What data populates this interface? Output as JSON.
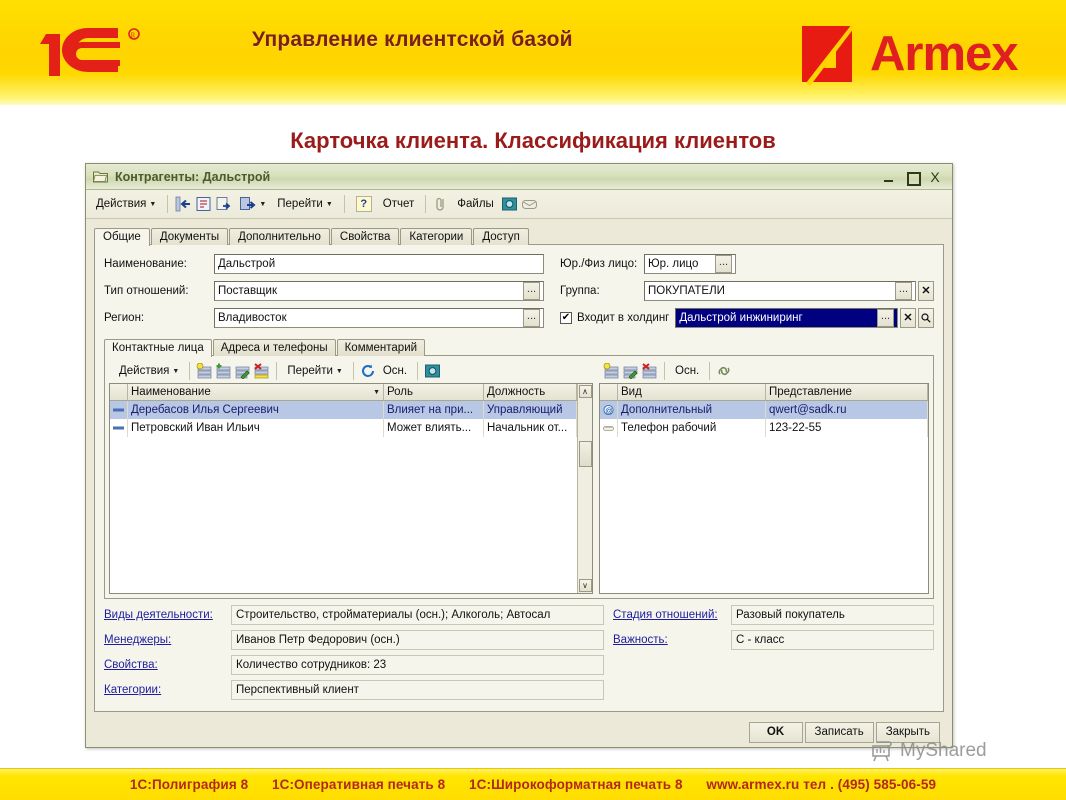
{
  "banner": {
    "title": "Управление клиентской базой",
    "brand_name": "Armex",
    "logo_1c": "1c-logo",
    "armex_mark": "armex-logo-mark",
    "yellow": "#ffd400",
    "red": "#e02020"
  },
  "slide": {
    "heading": "Карточка клиента. Классификация клиентов",
    "heading_color": "#9b1b1b"
  },
  "window": {
    "title": "Контрагенты: Дальстрой",
    "icon": "folder-icon",
    "minimize": "_",
    "maximize": "□",
    "close": "X"
  },
  "main_toolbar": {
    "actions_label": "Действия",
    "caret": "▼",
    "goto_label": "Перейти",
    "help_label": "?",
    "report_label": "Отчет",
    "files_label": "Файлы",
    "icons": [
      "back-arrow-icon",
      "structure-icon",
      "copy-icon",
      "move-icon",
      "paperclip-icon",
      "photo-icon",
      "envelope-icon"
    ]
  },
  "tabs": [
    {
      "label": "Общие",
      "active": true
    },
    {
      "label": "Документы",
      "active": false
    },
    {
      "label": "Дополнительно",
      "active": false
    },
    {
      "label": "Свойства",
      "active": false
    },
    {
      "label": "Категории",
      "active": false
    },
    {
      "label": "Доступ",
      "active": false
    }
  ],
  "form": {
    "left": [
      {
        "label": "Наименование:",
        "value": "Дальстрой",
        "has_picker": false
      },
      {
        "label": "Тип отношений:",
        "value": "Поставщик",
        "has_picker": true
      },
      {
        "label": "Регион:",
        "value": "Владивосток",
        "has_picker": true
      }
    ],
    "right": {
      "entity_type_label": "Юр./Физ лицо:",
      "entity_type_value": "Юр. лицо",
      "group_label": "Группа:",
      "group_value": "ПОКУПАТЕЛИ",
      "holding_checkbox_label": "Входит в холдинг",
      "holding_checked": "✔",
      "holding_value": "Дальстрой инжиниринг",
      "ellipsis": "...",
      "clear": "✕",
      "search": "🔍"
    }
  },
  "inner_tabs": [
    {
      "label": "Контактные лица",
      "active": true
    },
    {
      "label": "Адреса и телефоны",
      "active": false
    },
    {
      "label": "Комментарий",
      "active": false
    }
  ],
  "inner_toolbar_left": {
    "actions_label": "Действия",
    "caret": "▼",
    "goto_label": "Перейти",
    "main_label": "Осн.",
    "icons": [
      "add-row-icon",
      "add-copy-icon",
      "edit-row-icon",
      "delete-row-icon",
      "refresh-icon",
      "mail-icon"
    ]
  },
  "inner_toolbar_right": {
    "main_label": "Осн.",
    "icons": [
      "add-row-icon",
      "edit-row-icon",
      "delete-row-icon",
      "link-icon"
    ]
  },
  "contacts_grid": {
    "columns": [
      "Наименование",
      "Роль",
      "Должность"
    ],
    "sort_caret": "▼",
    "rows": [
      {
        "icon": "contact-person-icon",
        "name": "Деребасов Илья Сергеевич",
        "role": "Влияет на при...",
        "position": "Управляющий",
        "selected": true
      },
      {
        "icon": "contact-person-icon",
        "name": "Петровский Иван Ильич",
        "role": "Может влиять...",
        "position": "Начальник от...",
        "selected": false
      }
    ],
    "scroll_up": "∧",
    "scroll_down": "∨"
  },
  "contacts_info_grid": {
    "columns": [
      "Вид",
      "Представление"
    ],
    "rows": [
      {
        "icon": "at-sign-icon",
        "kind": "Дополнительный",
        "value": "qwert@sadk.ru",
        "selected": true
      },
      {
        "icon": "phone-icon",
        "kind": "Телефон рабочий",
        "value": "123-22-55",
        "selected": false
      }
    ]
  },
  "bottom_fields": {
    "left": [
      {
        "label": "Виды деятельности:",
        "value": "Строительство, стройматериалы (осн.); Алкоголь; Автосал"
      },
      {
        "label": "Менеджеры:",
        "value": "Иванов Петр Федорович (осн.)"
      },
      {
        "label": "Свойства:",
        "value": "Количество сотрудников: 23"
      },
      {
        "label": "Категории:",
        "value": "Перспективный клиент"
      }
    ],
    "right": [
      {
        "label": "Стадия отношений:",
        "value": "Разовый покупатель"
      },
      {
        "label": "Важность:",
        "value": "C - класс"
      }
    ]
  },
  "footer_buttons": [
    {
      "label": "OK",
      "bold": true
    },
    {
      "label": "Записать",
      "bold": false
    },
    {
      "label": "Закрыть",
      "bold": false
    }
  ],
  "watermark": {
    "text": "MyShared",
    "icon": "projector-icon"
  },
  "footer_bar": {
    "items": [
      "1С:Полиграфия 8",
      "1С:Оперативная печать 8",
      "1С:Широкоформатная печать 8",
      "www.armex.ru тел . (495) 585-06-59"
    ]
  }
}
